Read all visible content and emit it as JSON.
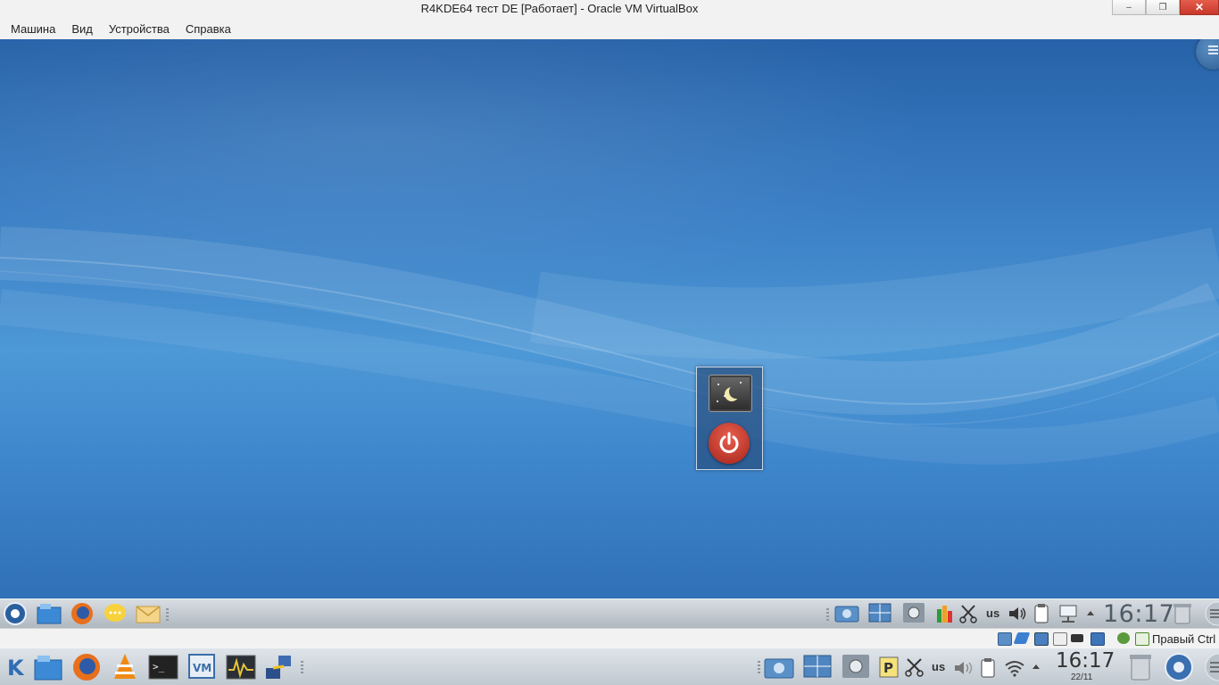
{
  "window": {
    "title": "R4KDE64 тест DE [Работает] - Oracle VM VirtualBox",
    "controls": {
      "minimize": "–",
      "maximize": "❐",
      "close": "✕"
    }
  },
  "menubar": {
    "items": [
      "Машина",
      "Вид",
      "Устройства",
      "Справка"
    ]
  },
  "guest": {
    "desktop": {
      "widget": {
        "sleep": "sleep-icon",
        "shutdown": "power-icon"
      }
    },
    "panel": {
      "launchers": [
        "kde-menu-icon",
        "file-manager-icon",
        "firefox-icon",
        "chat-icon",
        "mail-icon"
      ],
      "tray": [
        "screenshot-icon",
        "window-list-icon",
        "settings-icon",
        "package-icon",
        "scissors-icon",
        "keyboard-layout",
        "volume-icon",
        "clipboard-icon",
        "network-icon",
        "tray-expand-icon"
      ],
      "keyboard_layout": "us",
      "clock": "16:17"
    }
  },
  "vbox_status": {
    "host_key": "Правый Ctrl"
  },
  "host_panel": {
    "launchers": [
      "kde-start-icon",
      "file-manager-icon",
      "firefox-icon",
      "vlc-icon",
      "terminal-icon",
      "virtualbox-icon",
      "system-monitor-icon",
      "network-config-icon"
    ],
    "keyboard_layout": "us",
    "clock": "16:17",
    "date": "22/11"
  },
  "colors": {
    "desktop_top": "#2762a8",
    "desktop_mid": "#4d98d6",
    "power_red": "#c7382a"
  }
}
